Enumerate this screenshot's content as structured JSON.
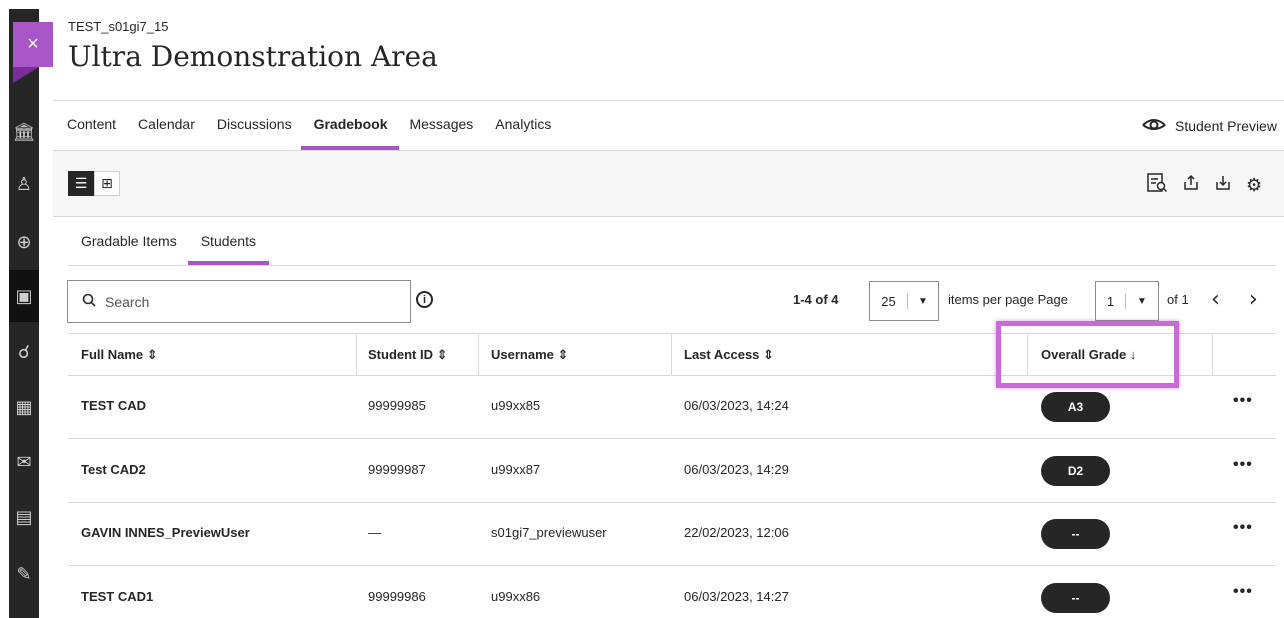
{
  "course": {
    "id": "TEST_s01gi7_15",
    "title": "Ultra Demonstration Area"
  },
  "tabs": [
    {
      "label": "Content",
      "active": false
    },
    {
      "label": "Calendar",
      "active": false
    },
    {
      "label": "Discussions",
      "active": false
    },
    {
      "label": "Gradebook",
      "active": true
    },
    {
      "label": "Messages",
      "active": false
    },
    {
      "label": "Analytics",
      "active": false
    }
  ],
  "student_preview_label": "Student Preview",
  "subtabs": [
    {
      "label": "Gradable Items",
      "active": false
    },
    {
      "label": "Students",
      "active": true
    }
  ],
  "search": {
    "placeholder": "Search"
  },
  "paging": {
    "range": "1-4 of 4",
    "per_page": "25",
    "per_page_label": "items per page",
    "page_label": "Page",
    "page": "1",
    "of_label": "of 1"
  },
  "columns": {
    "full_name": "Full Name",
    "student_id": "Student ID",
    "username": "Username",
    "last_access": "Last Access",
    "overall_grade": "Overall Grade"
  },
  "rows": [
    {
      "name": "TEST CAD",
      "student_id": "99999985",
      "username": "u99xx85",
      "last_access": "06/03/2023, 14:24",
      "grade": "A3"
    },
    {
      "name": "Test CAD2",
      "student_id": "99999987",
      "username": "u99xx87",
      "last_access": "06/03/2023, 14:29",
      "grade": "D2"
    },
    {
      "name": "GAVIN INNES_PreviewUser",
      "student_id": "—",
      "username": "s01gi7_previewuser",
      "last_access": "22/02/2023, 12:06",
      "grade": "--"
    },
    {
      "name": "TEST CAD1",
      "student_id": "99999986",
      "username": "u99xx86",
      "last_access": "06/03/2023, 14:27",
      "grade": "--"
    }
  ],
  "colors": {
    "accent": "#a855c8",
    "rail": "#262626",
    "highlight": "#c86ad8"
  }
}
